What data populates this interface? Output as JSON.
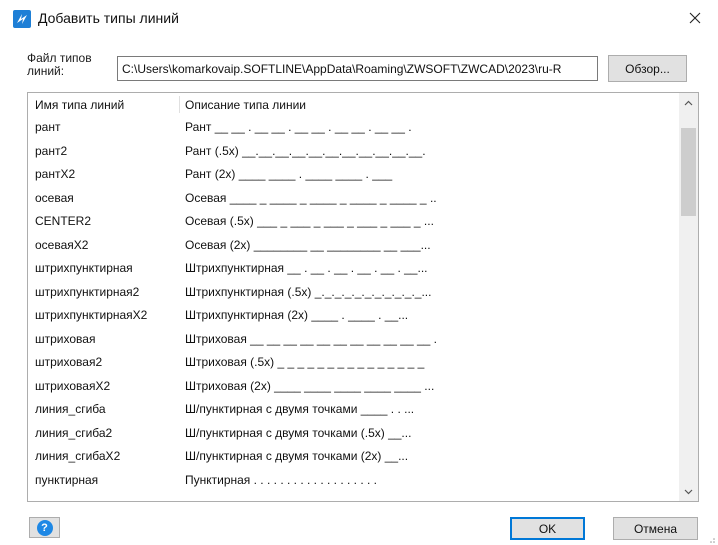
{
  "window": {
    "title": "Добавить типы линий",
    "icon": "zwcad-app-icon",
    "close_icon": "close-icon"
  },
  "file": {
    "label": "Файл типов линий:",
    "path": "C:\\Users\\komarkovaip.SOFTLINE\\AppData\\Roaming\\ZWSOFT\\ZWCAD\\2023\\ru-R",
    "browse_label": "Обзор..."
  },
  "list": {
    "columns": [
      "Имя типа линий",
      "Описание типа линии"
    ],
    "rows": [
      {
        "name": "рант",
        "desc": "Рант __ __ . __ __ . __ __ . __ __ . __ __ ."
      },
      {
        "name": "рант2",
        "desc": "Рант (.5x) __.__.__.__.__.__.__.__.__.__.__."
      },
      {
        "name": "рантХ2",
        "desc": "Рант (2x) ____ ____ . ____ ____ . ___"
      },
      {
        "name": "осевая",
        "desc": "Осевая ____ _ ____ _ ____ _ ____ _ ____ _ ..."
      },
      {
        "name": "CENTER2",
        "desc": "Осевая (.5x) ___ _ ___ _ ___ _ ___ _ ___ _ ..."
      },
      {
        "name": "осеваяХ2",
        "desc": "Осевая (2x) ________ __ ________ __ ___..."
      },
      {
        "name": "штрихпунктирная",
        "desc": "Штрихпунктирная __ . __ . __ . __ . __ . __..."
      },
      {
        "name": "штрихпунктирная2",
        "desc": "Штрихпунктирная (.5x) _._._._._._._._._._._..."
      },
      {
        "name": "штрихпунктирнаяХ2",
        "desc": "Штрихпунктирная (2x) ____ . ____ . __..."
      },
      {
        "name": "штриховая",
        "desc": "Штриховая __ __ __ __ __ __ __ __ __ __ __ ..."
      },
      {
        "name": "штриховая2",
        "desc": "Штриховая (.5x) _ _ _ _ _ _ _ _ _ _ _ _ _ _ _"
      },
      {
        "name": "штриховаяХ2",
        "desc": "Штриховая (2x) ____ ____ ____ ____ ____ ..."
      },
      {
        "name": "линия_сгиба",
        "desc": "Ш/пунктирная с двумя точками ____ . . ..."
      },
      {
        "name": "линия_сгиба2",
        "desc": "Ш/пунктирная с двумя точками (.5x) __..."
      },
      {
        "name": "линия_сгибаХ2",
        "desc": "Ш/пунктирная с двумя точками (2x) __..."
      },
      {
        "name": "пунктирная",
        "desc": "Пунктирная . . . . . . . . . . . . . . . . . . ."
      }
    ]
  },
  "buttons": {
    "help_icon": "help-icon",
    "ok_label": "OK",
    "cancel_label": "Отмена"
  }
}
